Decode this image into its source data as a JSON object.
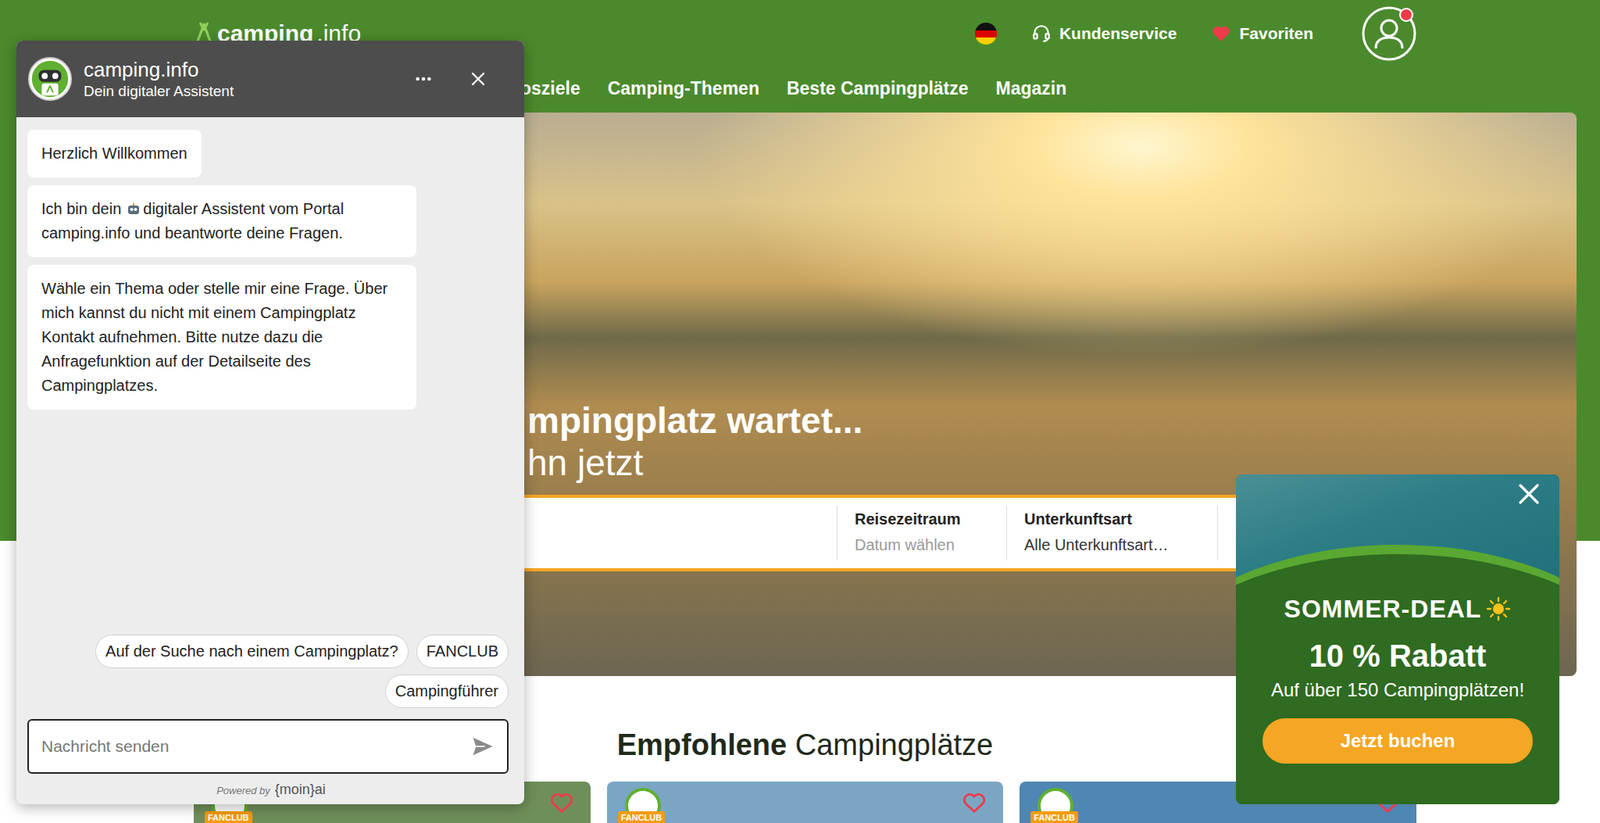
{
  "header": {
    "logo": {
      "bold": "camping",
      "light": ".info"
    },
    "service": {
      "label": "Kundenservice"
    },
    "favorites": {
      "label": "Favoriten"
    },
    "account": {
      "notification": true
    }
  },
  "nav": [
    {
      "label": "osziele"
    },
    {
      "label": "Camping-Themen"
    },
    {
      "label": "Beste Campingplätze"
    },
    {
      "label": "Magazin"
    }
  ],
  "hero": {
    "headline": "mpingplatz wartet...",
    "subline": "hn jetzt"
  },
  "search": {
    "fields": [
      {
        "label": "Reisezeitraum",
        "value": "Datum wählen",
        "placeholder": true
      },
      {
        "label": "Unterkunftsart",
        "value": "Alle Unterkunftsart…",
        "placeholder": false
      }
    ]
  },
  "recommended": {
    "title_bold": "Empfohlene",
    "title_rest": "Campingplätze",
    "cards": [
      {
        "badge": "FANCLUB",
        "favorite": false,
        "color": "#6f8f5a"
      },
      {
        "badge": "FANCLUB",
        "favorite": false,
        "color": "#7aa6c4"
      },
      {
        "badge": "FANCLUB",
        "favorite": false,
        "color": "#4f86b3"
      }
    ]
  },
  "chat": {
    "title": "camping.info",
    "subtitle": "Dein digitaler Assistent",
    "messages": [
      {
        "kind": "plain",
        "prefix": "",
        "text": "Herzlich Willkommen"
      },
      {
        "kind": "with-icon",
        "prefix": "Ich bin dein",
        "text": "digitaler Assistent vom Portal camping.info und beantworte deine Fragen."
      },
      {
        "kind": "plain",
        "prefix": "",
        "text": "Wähle ein Thema oder stelle mir eine Frage. Über mich kannst du nicht mit einem Campingplatz Kontakt aufnehmen. Bitte nutze dazu die Anfragefunktion auf der Detailseite des Campingplatzes."
      }
    ],
    "quick_replies": [
      "Auf der Suche nach einem Campingplatz?",
      "FANCLUB",
      "Campingführer"
    ],
    "input": {
      "placeholder": "Nachricht senden"
    },
    "footer": {
      "powered": "Powered by",
      "brand": "{moin}ai"
    }
  },
  "promo": {
    "title": "SOMMER-DEAL",
    "discount": "10 % Rabatt",
    "text": "Auf über 150 Campingplätzen!",
    "button": "Jetzt buchen"
  }
}
